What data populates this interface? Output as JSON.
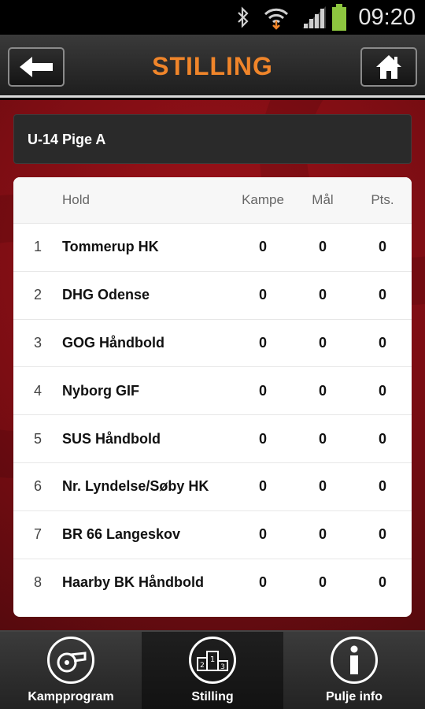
{
  "status_bar": {
    "time": "09:20"
  },
  "header": {
    "title": "STILLING"
  },
  "pool": {
    "name": "U-14 Pige A"
  },
  "table": {
    "columns": {
      "hold": "Hold",
      "kampe": "Kampe",
      "mal": "Mål",
      "pts": "Pts."
    },
    "rows": [
      {
        "rank": "1",
        "team": "Tommerup HK",
        "kampe": "0",
        "mal": "0",
        "pts": "0"
      },
      {
        "rank": "2",
        "team": "DHG Odense",
        "kampe": "0",
        "mal": "0",
        "pts": "0"
      },
      {
        "rank": "3",
        "team": "GOG Håndbold",
        "kampe": "0",
        "mal": "0",
        "pts": "0"
      },
      {
        "rank": "4",
        "team": "Nyborg GIF",
        "kampe": "0",
        "mal": "0",
        "pts": "0"
      },
      {
        "rank": "5",
        "team": "SUS Håndbold",
        "kampe": "0",
        "mal": "0",
        "pts": "0"
      },
      {
        "rank": "6",
        "team": "Nr. Lyndelse/Søby HK",
        "kampe": "0",
        "mal": "0",
        "pts": "0"
      },
      {
        "rank": "7",
        "team": "BR 66 Langeskov",
        "kampe": "0",
        "mal": "0",
        "pts": "0"
      },
      {
        "rank": "8",
        "team": "Haarby BK Håndbold",
        "kampe": "0",
        "mal": "0",
        "pts": "0"
      }
    ]
  },
  "tabs": [
    {
      "label": "Kampprogram",
      "icon": "whistle-icon"
    },
    {
      "label": "Stilling",
      "icon": "podium-icon"
    },
    {
      "label": "Pulje info",
      "icon": "info-icon"
    }
  ],
  "colors": {
    "accent": "#f0852a",
    "background": "#7c0d13"
  }
}
